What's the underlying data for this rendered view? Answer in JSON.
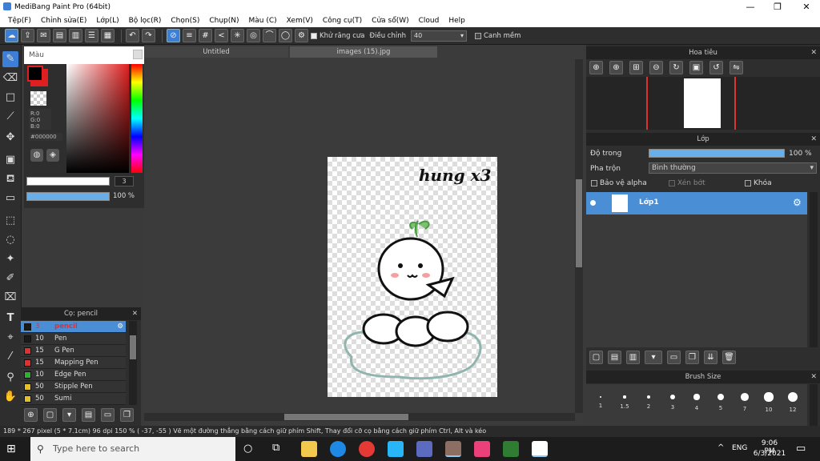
{
  "window": {
    "title": "MediBang Paint Pro (64bit)"
  },
  "menu": [
    "Tệp(F)",
    "Chỉnh sửa(E)",
    "Lớp(L)",
    "Bộ lọc(R)",
    "Chọn(S)",
    "Chụp(N)",
    "Màu (C)",
    "Xem(V)",
    "Công cụ(T)",
    "Cửa sổ(W)",
    "Cloud",
    "Help"
  ],
  "toolbar": {
    "antialias_label": "Khử răng cưa",
    "correction_label": "Điều chỉnh",
    "correction_value": "40",
    "snap_label": "Canh mềm"
  },
  "color_panel": {
    "title": "Màu",
    "rgb": [
      "R:0",
      "G:0",
      "B:0"
    ],
    "hex": "#000000",
    "brush_size": "3",
    "opacity": "100 %"
  },
  "brush_panel": {
    "title": "Cọ: pencil",
    "brushes": [
      {
        "size": "3",
        "name": "pencil",
        "color": "#1a1a1a",
        "selected": true
      },
      {
        "size": "10",
        "name": "Pen",
        "color": "#1a1a1a"
      },
      {
        "size": "15",
        "name": "G Pen",
        "color": "#e03030"
      },
      {
        "size": "15",
        "name": "Mapping Pen",
        "color": "#e03030"
      },
      {
        "size": "10",
        "name": "Edge Pen",
        "color": "#30b030"
      },
      {
        "size": "50",
        "name": "Stipple Pen",
        "color": "#e6c020"
      },
      {
        "size": "50",
        "name": "Sumi",
        "color": "#e6c020"
      }
    ]
  },
  "tabs": [
    "Untitled",
    "images (15).jpg"
  ],
  "navigator": {
    "title": "Hoa tiêu"
  },
  "layer_panel": {
    "title": "Lớp",
    "opacity_label": "Độ trong",
    "opacity_value": "100 %",
    "blend_label": "Pha trộn",
    "blend_value": "Bình thường",
    "protect_alpha": "Bảo vệ alpha",
    "clip": "Xén bớt",
    "lock": "Khóa",
    "layers": [
      {
        "name": "Lớp1"
      }
    ]
  },
  "brush_size_panel": {
    "title": "Brush Size",
    "sizes": [
      "1",
      "1.5",
      "2",
      "3",
      "4",
      "5",
      "7",
      "10",
      "12"
    ]
  },
  "status": {
    "text": "189 * 267 pixel   (5 * 7.1cm)   96 dpi   150 %   ( -37, -55 )   Vẽ một đường thẳng bằng cách giữ phím Shift, Thay đổi cỡ cọ bằng cách giữ phím Ctrl, Alt và kéo"
  },
  "taskbar": {
    "search_placeholder": "Type here to search",
    "lang": "ENG",
    "time": "9:06 PM",
    "date": "6/3/2021"
  },
  "drawing": {
    "caption": "hung x3"
  }
}
